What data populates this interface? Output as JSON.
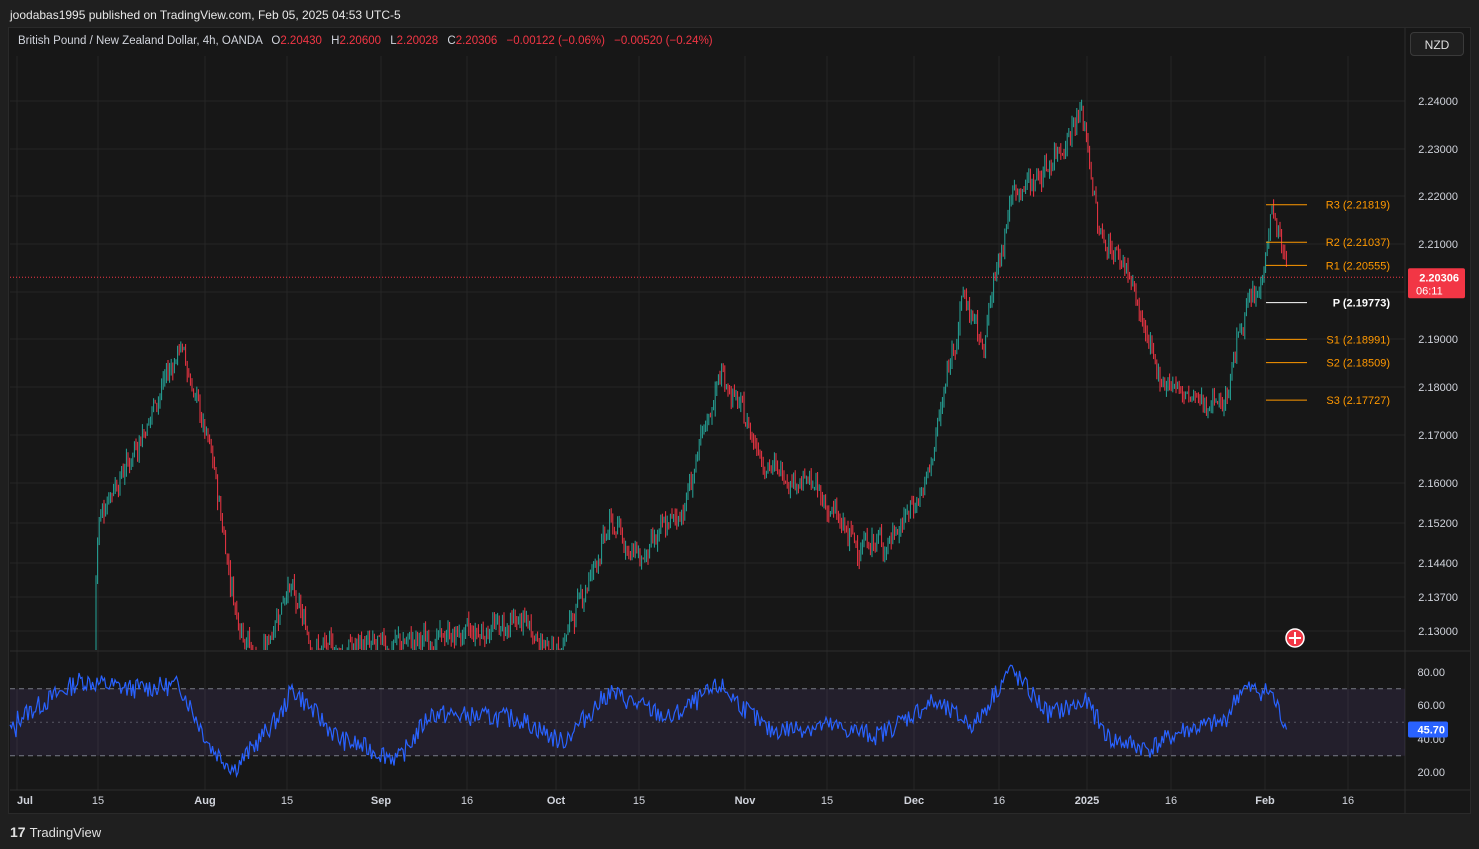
{
  "header": {
    "published": "joodabas1995 published on TradingView.com, Feb 05, 2025 04:53 UTC-5"
  },
  "legend": {
    "symbol": "British Pound / New Zealand Dollar, 4h, OANDA",
    "o_label": "O",
    "o_value": "2.20430",
    "h_label": "H",
    "h_value": "2.20600",
    "l_label": "L",
    "l_value": "2.20028",
    "c_label": "C",
    "c_value": "2.20306",
    "change": "−0.00122 (−0.06%)",
    "change2": "−0.00520 (−0.24%)"
  },
  "currency_button": "NZD",
  "footer": {
    "logo_mark": "17",
    "logo_text": "TradingView"
  },
  "colors": {
    "up": "#26a69a",
    "down": "#f23645",
    "pivot_orange": "#ff9800",
    "pivot_white": "#ffffff",
    "rsi_line": "#2962ff",
    "rsi_band": "#7e57c2"
  },
  "chart_data": [
    {
      "type": "candlestick",
      "title": "British Pound / New Zealand Dollar, 4h, OANDA",
      "x_ticks": [
        "Jul",
        "15",
        "Aug",
        "15",
        "Sep",
        "16",
        "Oct",
        "15",
        "Nov",
        "15",
        "Dec",
        "16",
        "2025",
        "16",
        "Feb",
        "16"
      ],
      "y_ticks": [
        "2.24000",
        "2.23000",
        "2.22000",
        "2.21000",
        "2.20000",
        "2.19000",
        "2.18000",
        "2.17000",
        "2.16000",
        "2.15200",
        "2.14400",
        "2.13700",
        "2.13000"
      ],
      "ylim": [
        2.122,
        2.245
      ],
      "last_price": "2.20306",
      "countdown": "06:11",
      "approx_close_path": [
        {
          "x": "Jul",
          "y": 2.122
        },
        {
          "x": "Jul 10",
          "y": 2.145
        },
        {
          "x": "Jul 20",
          "y": 2.165
        },
        {
          "x": "Jul 28",
          "y": 2.189
        },
        {
          "x": "Aug 02",
          "y": 2.165
        },
        {
          "x": "Aug 06",
          "y": 2.135
        },
        {
          "x": "Aug 10",
          "y": 2.122
        },
        {
          "x": "Aug 15",
          "y": 2.14
        },
        {
          "x": "Aug 20",
          "y": 2.126
        },
        {
          "x": "Sep 10",
          "y": 2.128
        },
        {
          "x": "Sep 25",
          "y": 2.132
        },
        {
          "x": "Oct 01",
          "y": 2.125
        },
        {
          "x": "Oct 10",
          "y": 2.152
        },
        {
          "x": "Oct 15",
          "y": 2.145
        },
        {
          "x": "Oct 22",
          "y": 2.155
        },
        {
          "x": "Oct 28",
          "y": 2.183
        },
        {
          "x": "Nov 05",
          "y": 2.163
        },
        {
          "x": "Nov 12",
          "y": 2.16
        },
        {
          "x": "Nov 20",
          "y": 2.148
        },
        {
          "x": "Nov 27",
          "y": 2.148
        },
        {
          "x": "Dec 04",
          "y": 2.16
        },
        {
          "x": "Dec 10",
          "y": 2.2
        },
        {
          "x": "Dec 13",
          "y": 2.188
        },
        {
          "x": "Dec 18",
          "y": 2.22
        },
        {
          "x": "Dec 24",
          "y": 2.225
        },
        {
          "x": "Dec 31",
          "y": 2.238
        },
        {
          "x": "Jan 03",
          "y": 2.212
        },
        {
          "x": "Jan 08",
          "y": 2.205
        },
        {
          "x": "Jan 13",
          "y": 2.183
        },
        {
          "x": "Jan 20",
          "y": 2.177
        },
        {
          "x": "Jan 25",
          "y": 2.177
        },
        {
          "x": "Jan 28",
          "y": 2.195
        },
        {
          "x": "Jan 31",
          "y": 2.2
        },
        {
          "x": "Feb 02",
          "y": 2.218
        },
        {
          "x": "Feb 05",
          "y": 2.20306
        }
      ],
      "pivot_levels": [
        {
          "label": "R3 (2.21819)",
          "value": 2.21819
        },
        {
          "label": "R2 (2.21037)",
          "value": 2.21037
        },
        {
          "label": "R1 (2.20555)",
          "value": 2.20555
        },
        {
          "label": "P (2.19773)",
          "value": 2.19773
        },
        {
          "label": "S1 (2.18991)",
          "value": 2.18991
        },
        {
          "label": "S2 (2.18509)",
          "value": 2.18509
        },
        {
          "label": "S3 (2.17727)",
          "value": 2.17727
        }
      ]
    },
    {
      "type": "line",
      "title": "RSI",
      "y_ticks": [
        "80.00",
        "60.00",
        "40.00",
        "20.00"
      ],
      "ylim": [
        15,
        85
      ],
      "band": [
        30,
        70
      ],
      "midline": 50,
      "last_value": "45.70",
      "approx_values": [
        {
          "x": "Jul",
          "y": 52
        },
        {
          "x": "Jul 12",
          "y": 75
        },
        {
          "x": "Jul 20",
          "y": 70
        },
        {
          "x": "Jul 28",
          "y": 72
        },
        {
          "x": "Aug 02",
          "y": 35
        },
        {
          "x": "Aug 06",
          "y": 22
        },
        {
          "x": "Aug 14",
          "y": 55
        },
        {
          "x": "Aug 16",
          "y": 70
        },
        {
          "x": "Aug 25",
          "y": 40
        },
        {
          "x": "Sep 05",
          "y": 28
        },
        {
          "x": "Sep 10",
          "y": 55
        },
        {
          "x": "Sep 25",
          "y": 52
        },
        {
          "x": "Oct 02",
          "y": 38
        },
        {
          "x": "Oct 10",
          "y": 68
        },
        {
          "x": "Oct 20",
          "y": 52
        },
        {
          "x": "Oct 28",
          "y": 72
        },
        {
          "x": "Nov 05",
          "y": 45
        },
        {
          "x": "Nov 15",
          "y": 48
        },
        {
          "x": "Nov 25",
          "y": 42
        },
        {
          "x": "Dec 05",
          "y": 62
        },
        {
          "x": "Dec 12",
          "y": 48
        },
        {
          "x": "Dec 18",
          "y": 82
        },
        {
          "x": "Dec 25",
          "y": 55
        },
        {
          "x": "Jan 01",
          "y": 62
        },
        {
          "x": "Jan 05",
          "y": 40
        },
        {
          "x": "Jan 12",
          "y": 34
        },
        {
          "x": "Jan 18",
          "y": 45
        },
        {
          "x": "Jan 25",
          "y": 50
        },
        {
          "x": "Jan 28",
          "y": 70
        },
        {
          "x": "Feb 02",
          "y": 68
        },
        {
          "x": "Feb 05",
          "y": 45.7
        }
      ]
    }
  ]
}
